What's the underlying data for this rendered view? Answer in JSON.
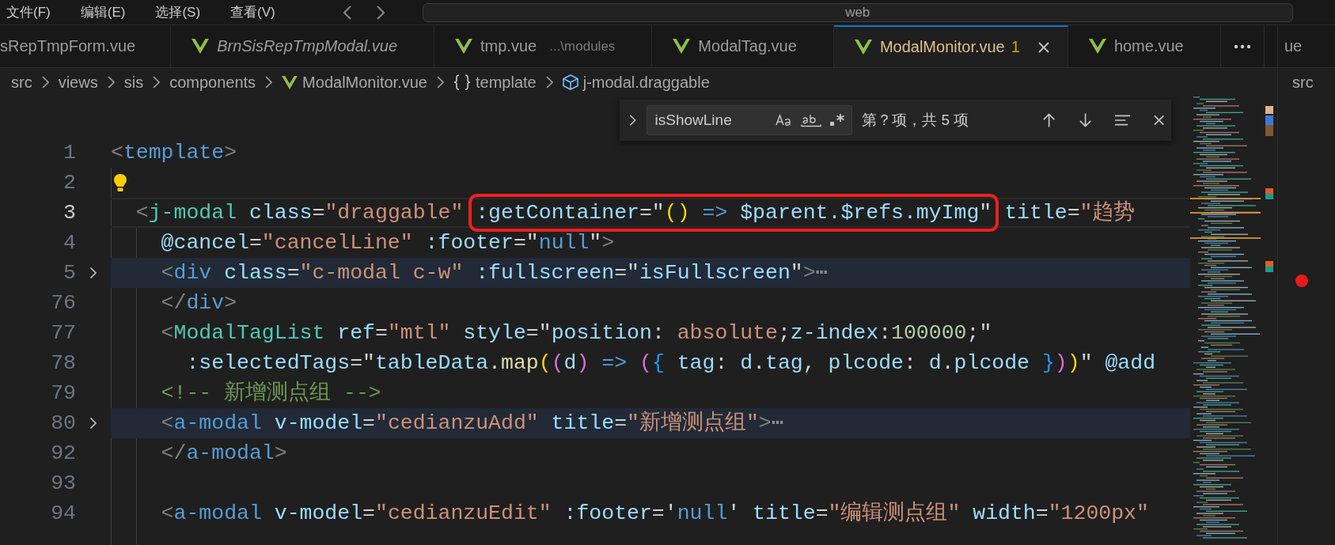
{
  "menu": [
    {
      "label": "文件(F)"
    },
    {
      "label": "编辑(E)"
    },
    {
      "label": "选择(S)"
    },
    {
      "label": "查看(V)"
    }
  ],
  "command_center": {
    "text": "web"
  },
  "tabs": [
    {
      "label": "sRepTmpForm.vue",
      "icon": false,
      "preview": false,
      "selected": false
    },
    {
      "label": "BrnSisRepTmpModal.vue",
      "icon": true,
      "preview": true,
      "selected": false
    },
    {
      "label": "tmp.vue",
      "description": "...\\modules",
      "icon": true,
      "preview": false,
      "selected": false
    },
    {
      "label": "ModalTag.vue",
      "icon": true,
      "preview": false,
      "selected": false
    },
    {
      "label": "ModalMonitor.vue",
      "problems": "1",
      "icon": true,
      "preview": false,
      "selected": true
    },
    {
      "label": "home.vue",
      "icon": true,
      "preview": false,
      "selected": false
    }
  ],
  "side_group": {
    "tab": "ue",
    "breadcrumb": "src"
  },
  "breadcrumb": [
    {
      "label": "src",
      "kind": "folder"
    },
    {
      "label": "views",
      "kind": "folder"
    },
    {
      "label": "sis",
      "kind": "folder"
    },
    {
      "label": "components",
      "kind": "folder"
    },
    {
      "label": "ModalMonitor.vue",
      "kind": "file"
    },
    {
      "label": "template",
      "kind": "object"
    },
    {
      "label": "j-modal.draggable",
      "kind": "element"
    }
  ],
  "find": {
    "value": "isShowLine",
    "result": "第？项，共 5 项"
  },
  "lines": [
    {
      "number": "1",
      "current": false,
      "folded": false,
      "lightbulb": false,
      "tokens": [
        {
          "kind": "punct",
          "text": "<"
        },
        {
          "kind": "tag",
          "text": "template"
        },
        {
          "kind": "punct",
          "text": ">"
        }
      ]
    },
    {
      "number": "2",
      "current": false,
      "folded": false,
      "lightbulb": true
    },
    {
      "number": "3",
      "current": true,
      "folded": false,
      "lightbulb": false,
      "tokens": [
        {
          "kind": "punct",
          "text": "  <"
        },
        {
          "kind": "comp",
          "text": "j-modal"
        },
        {
          "kind": "attr",
          "text": " class"
        },
        {
          "kind": "eq",
          "text": "="
        },
        {
          "kind": "str",
          "text": "\"draggable\" "
        }
      ],
      "boxed_tokens": [
        {
          "kind": "attr",
          "text": ":getContainer"
        },
        {
          "kind": "eq",
          "text": "="
        },
        {
          "kind": "plain",
          "text": "\""
        },
        {
          "kind": "b1",
          "text": "()"
        },
        {
          "kind": "kw",
          "text": " =>"
        },
        {
          "kind": "var",
          "text": " $parent.$refs.myImg"
        },
        {
          "kind": "plain",
          "text": "\""
        }
      ],
      "tokens_after": [
        {
          "kind": "attr",
          "text": " title"
        },
        {
          "kind": "eq",
          "text": "="
        },
        {
          "kind": "str",
          "text": "\"趋势"
        }
      ]
    },
    {
      "number": "4",
      "current": false,
      "folded": false,
      "lightbulb": false,
      "tokens": [
        {
          "kind": "attr",
          "text": "    @cancel"
        },
        {
          "kind": "eq",
          "text": "="
        },
        {
          "kind": "str",
          "text": "\"cancelLine\""
        },
        {
          "kind": "attr",
          "text": " :footer"
        },
        {
          "kind": "eq",
          "text": "="
        },
        {
          "kind": "plain",
          "text": "\""
        },
        {
          "kind": "kw",
          "text": "null"
        },
        {
          "kind": "plain",
          "text": "\""
        },
        {
          "kind": "punct",
          "text": ">"
        }
      ]
    },
    {
      "number": "5",
      "current": false,
      "folded": true,
      "lightbulb": false,
      "tokens": [
        {
          "kind": "punct",
          "text": "    <"
        },
        {
          "kind": "tag",
          "text": "div"
        },
        {
          "kind": "attr",
          "text": " class"
        },
        {
          "kind": "eq",
          "text": "="
        },
        {
          "kind": "str",
          "text": "\"c-modal c-w\""
        },
        {
          "kind": "attr",
          "text": " :fullscreen"
        },
        {
          "kind": "eq",
          "text": "="
        },
        {
          "kind": "plain",
          "text": "\""
        },
        {
          "kind": "var",
          "text": "isFullscreen"
        },
        {
          "kind": "plain",
          "text": "\""
        },
        {
          "kind": "punct",
          "text": ">"
        },
        {
          "kind": "ell",
          "text": "⋯"
        }
      ]
    },
    {
      "number": "76",
      "current": false,
      "folded": false,
      "lightbulb": false,
      "tokens": [
        {
          "kind": "punct",
          "text": "    </"
        },
        {
          "kind": "tag",
          "text": "div"
        },
        {
          "kind": "punct",
          "text": ">"
        }
      ]
    },
    {
      "number": "77",
      "current": false,
      "folded": false,
      "lightbulb": false,
      "tokens": [
        {
          "kind": "punct",
          "text": "    <"
        },
        {
          "kind": "comp",
          "text": "ModalTagList"
        },
        {
          "kind": "attr",
          "text": " ref"
        },
        {
          "kind": "eq",
          "text": "="
        },
        {
          "kind": "str",
          "text": "\"mtl\""
        },
        {
          "kind": "attr",
          "text": " style"
        },
        {
          "kind": "eq",
          "text": "="
        },
        {
          "kind": "plain",
          "text": "\""
        },
        {
          "kind": "var",
          "text": "position"
        },
        {
          "kind": "plain",
          "text": ": "
        },
        {
          "kind": "str",
          "text": "absolute"
        },
        {
          "kind": "plain",
          "text": ";"
        },
        {
          "kind": "var",
          "text": "z-index"
        },
        {
          "kind": "plain",
          "text": ":"
        },
        {
          "kind": "num",
          "text": "100000"
        },
        {
          "kind": "plain",
          "text": ";\""
        }
      ]
    },
    {
      "number": "78",
      "current": false,
      "folded": false,
      "lightbulb": false,
      "tokens": [
        {
          "kind": "attr",
          "text": "      :selectedTags"
        },
        {
          "kind": "eq",
          "text": "="
        },
        {
          "kind": "plain",
          "text": "\""
        },
        {
          "kind": "var",
          "text": "tableData"
        },
        {
          "kind": "plain",
          "text": "."
        },
        {
          "kind": "func",
          "text": "map"
        },
        {
          "kind": "b1",
          "text": "("
        },
        {
          "kind": "b2",
          "text": "("
        },
        {
          "kind": "var",
          "text": "d"
        },
        {
          "kind": "b2",
          "text": ")"
        },
        {
          "kind": "kw",
          "text": " => "
        },
        {
          "kind": "b2",
          "text": "("
        },
        {
          "kind": "b3",
          "text": "{"
        },
        {
          "kind": "var",
          "text": " tag"
        },
        {
          "kind": "plain",
          "text": ": "
        },
        {
          "kind": "var",
          "text": "d"
        },
        {
          "kind": "plain",
          "text": "."
        },
        {
          "kind": "var",
          "text": "tag"
        },
        {
          "kind": "plain",
          "text": ", "
        },
        {
          "kind": "var",
          "text": "plcode"
        },
        {
          "kind": "plain",
          "text": ": "
        },
        {
          "kind": "var",
          "text": "d"
        },
        {
          "kind": "plain",
          "text": "."
        },
        {
          "kind": "var",
          "text": "plcode "
        },
        {
          "kind": "b3",
          "text": "}"
        },
        {
          "kind": "b2",
          "text": ")"
        },
        {
          "kind": "b1",
          "text": ")"
        },
        {
          "kind": "plain",
          "text": "\""
        },
        {
          "kind": "attr",
          "text": " @add"
        }
      ]
    },
    {
      "number": "79",
      "current": false,
      "folded": false,
      "lightbulb": false,
      "tokens": [
        {
          "kind": "comment",
          "text": "    <!-- 新增测点组 -->"
        }
      ]
    },
    {
      "number": "80",
      "current": false,
      "folded": true,
      "lightbulb": false,
      "tokens": [
        {
          "kind": "punct",
          "text": "    <"
        },
        {
          "kind": "tag",
          "text": "a-modal"
        },
        {
          "kind": "attr",
          "text": " v-model"
        },
        {
          "kind": "eq",
          "text": "="
        },
        {
          "kind": "str",
          "text": "\"cedianzuAdd\""
        },
        {
          "kind": "attr",
          "text": " title"
        },
        {
          "kind": "eq",
          "text": "="
        },
        {
          "kind": "str",
          "text": "\"新增测点组\""
        },
        {
          "kind": "punct",
          "text": ">"
        },
        {
          "kind": "ell",
          "text": "⋯"
        }
      ]
    },
    {
      "number": "92",
      "current": false,
      "folded": false,
      "lightbulb": false,
      "tokens": [
        {
          "kind": "punct",
          "text": "    </"
        },
        {
          "kind": "tag",
          "text": "a-modal"
        },
        {
          "kind": "punct",
          "text": ">"
        }
      ]
    },
    {
      "number": "93",
      "current": false,
      "folded": false,
      "lightbulb": false
    },
    {
      "number": "94",
      "current": false,
      "folded": false,
      "lightbulb": false,
      "tokens": [
        {
          "kind": "punct",
          "text": "    <"
        },
        {
          "kind": "tag",
          "text": "a-modal"
        },
        {
          "kind": "attr",
          "text": " v-model"
        },
        {
          "kind": "eq",
          "text": "="
        },
        {
          "kind": "str",
          "text": "\"cedianzuEdit\""
        },
        {
          "kind": "attr",
          "text": " :footer"
        },
        {
          "kind": "eq",
          "text": "="
        },
        {
          "kind": "plain",
          "text": "'"
        },
        {
          "kind": "kw",
          "text": "null"
        },
        {
          "kind": "plain",
          "text": "'"
        },
        {
          "kind": "attr",
          "text": " title"
        },
        {
          "kind": "eq",
          "text": "="
        },
        {
          "kind": "str",
          "text": "\"编辑测点组\""
        },
        {
          "kind": "attr",
          "text": " width"
        },
        {
          "kind": "eq",
          "text": "="
        },
        {
          "kind": "str",
          "text": "\"1200px\""
        }
      ]
    }
  ]
}
